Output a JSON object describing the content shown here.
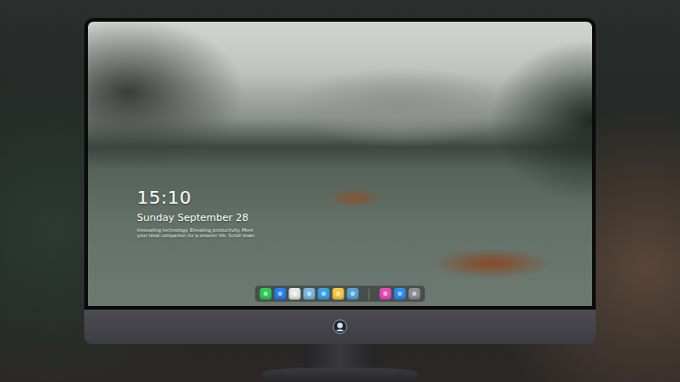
{
  "desktop": {
    "clock": {
      "time": "15:10",
      "date": "Sunday September 28"
    },
    "tagline": [
      "Innovating technology. Elevating productivity. Meet",
      "your ideal companion for a smarter life. Scroll down"
    ]
  },
  "dock": {
    "apps": [
      {
        "color": "#34c759"
      },
      {
        "color": "#2a7ff0"
      },
      {
        "color": "#e6e6e6"
      },
      {
        "color": "#7ab8e0"
      },
      {
        "color": "#3aa0e8"
      },
      {
        "color": "#f5c842"
      },
      {
        "color": "#5aa0d8"
      }
    ],
    "pinned": [
      {
        "color": "#e84bb8"
      },
      {
        "color": "#2f8cf0"
      },
      {
        "color": "#8e8e93"
      }
    ]
  }
}
